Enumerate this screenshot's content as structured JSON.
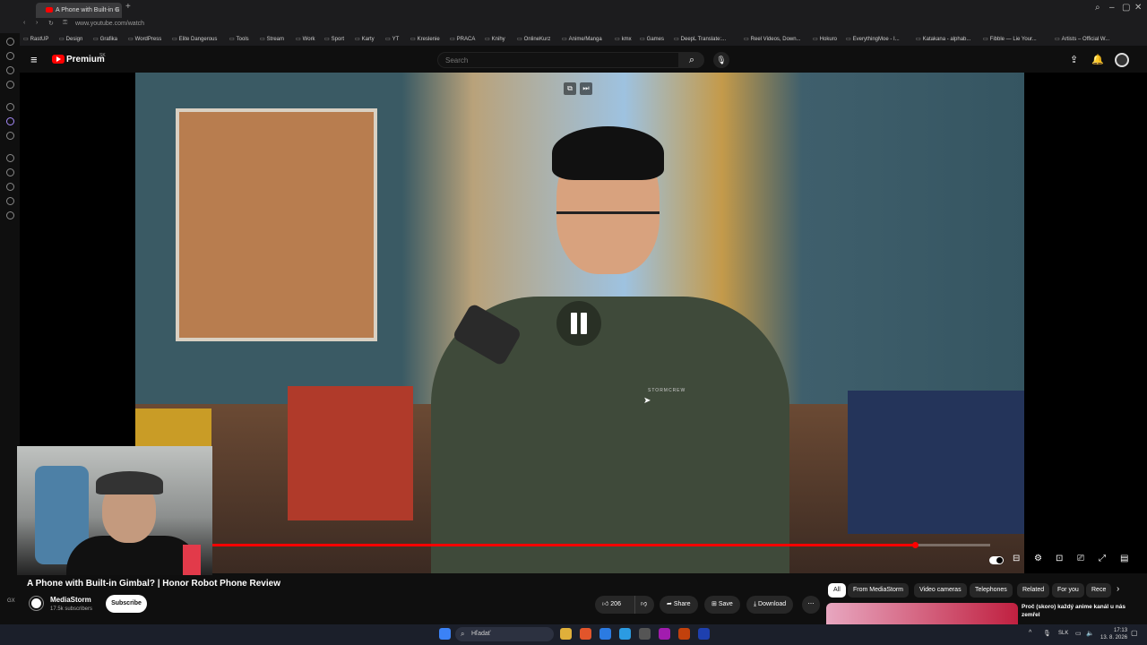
{
  "browser": {
    "tab_title": "A Phone with Built-in G",
    "url": "www.youtube.com/watch",
    "bookmarks": [
      "RastUP",
      "Design",
      "Grafika",
      "WordPress",
      "Elite Dangerous",
      "Tools",
      "Stream",
      "Work",
      "Sport",
      "Karty",
      "YT",
      "Kreslenie",
      "PRACA",
      "Knihy",
      "OnlineKurz",
      "Anime/Manga",
      "kmx",
      "Games",
      "DeepL Translate:...",
      "Reel Videos, Down...",
      "Hokuro",
      "EverythingMoe - I...",
      "Katakana - alphab...",
      "Fibble — Lie Your...",
      "Artists – Official W..."
    ]
  },
  "youtube": {
    "brand": "Premium",
    "brand_sup": "SK",
    "search_placeholder": "Search"
  },
  "video": {
    "shirt_text": "STORMCREW",
    "progress_fraction": 0.903,
    "loaded_fraction": 1.0
  },
  "info": {
    "title": "A Phone with Built-in Gimbal? | Honor Robot Phone Review",
    "channel": "MediaStorm",
    "subscribers": "17.5k subscribers",
    "subscribe_label": "Subscribe",
    "likes": "206",
    "share_label": "Share",
    "save_label": "Save",
    "download_label": "Download"
  },
  "chips": [
    "All",
    "From MediaStorm",
    "Video cameras",
    "Telephones",
    "Related",
    "For you",
    "Rece"
  ],
  "recommendation": {
    "title": "Proč (skoro) každý anime kanál u nás zemřel"
  },
  "taskbar": {
    "search_placeholder": "Hľadať",
    "language": "SLK",
    "time": "17:13",
    "date": "13. 8. 2026"
  },
  "left_label": "GX",
  "colors": {
    "accent": "#ff0000",
    "background": "#0f0f0f"
  }
}
